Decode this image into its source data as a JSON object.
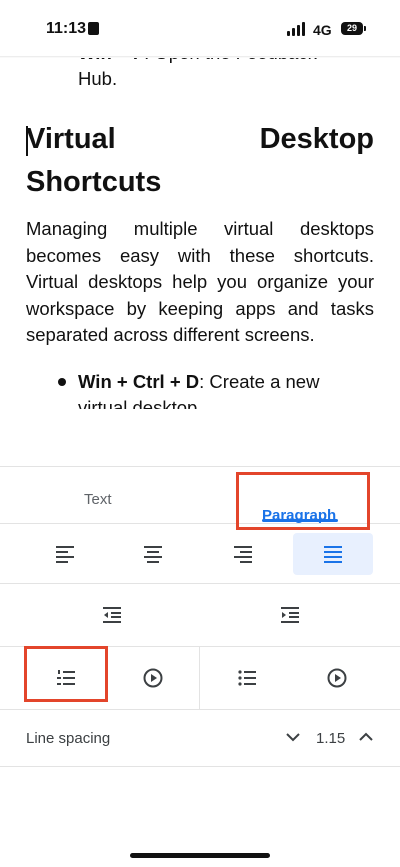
{
  "status_bar": {
    "time": "11:13",
    "network": "4G",
    "battery": "29"
  },
  "document": {
    "bullet1_bold": "Win + F",
    "bullet1_rest": ": Open the Feedback",
    "bullet1_line2": "Hub.",
    "heading_word1": "Virtual",
    "heading_word2": "Desktop",
    "heading_line2": "Shortcuts",
    "paragraph": "Managing multiple virtual desktops becomes easy with these shortcuts. Virtual desktops help you organize your workspace by keeping apps and tasks separated across different screens.",
    "bullet2_bold": "Win + Ctrl + D",
    "bullet2_rest": ": Create a new",
    "bullet2_line2": "virtual desktop"
  },
  "panel": {
    "tabs": [
      {
        "label": "Text"
      },
      {
        "label": "Paragraph"
      }
    ],
    "align_buttons": [
      "align-left",
      "align-center",
      "align-right",
      "justify"
    ],
    "active_align": "justify",
    "line_spacing": {
      "label": "Line spacing",
      "value": "1.15"
    }
  },
  "colors": {
    "accent": "#1a73e8",
    "highlight_box": "#e3452b",
    "active_bg": "#e8f0fe"
  }
}
